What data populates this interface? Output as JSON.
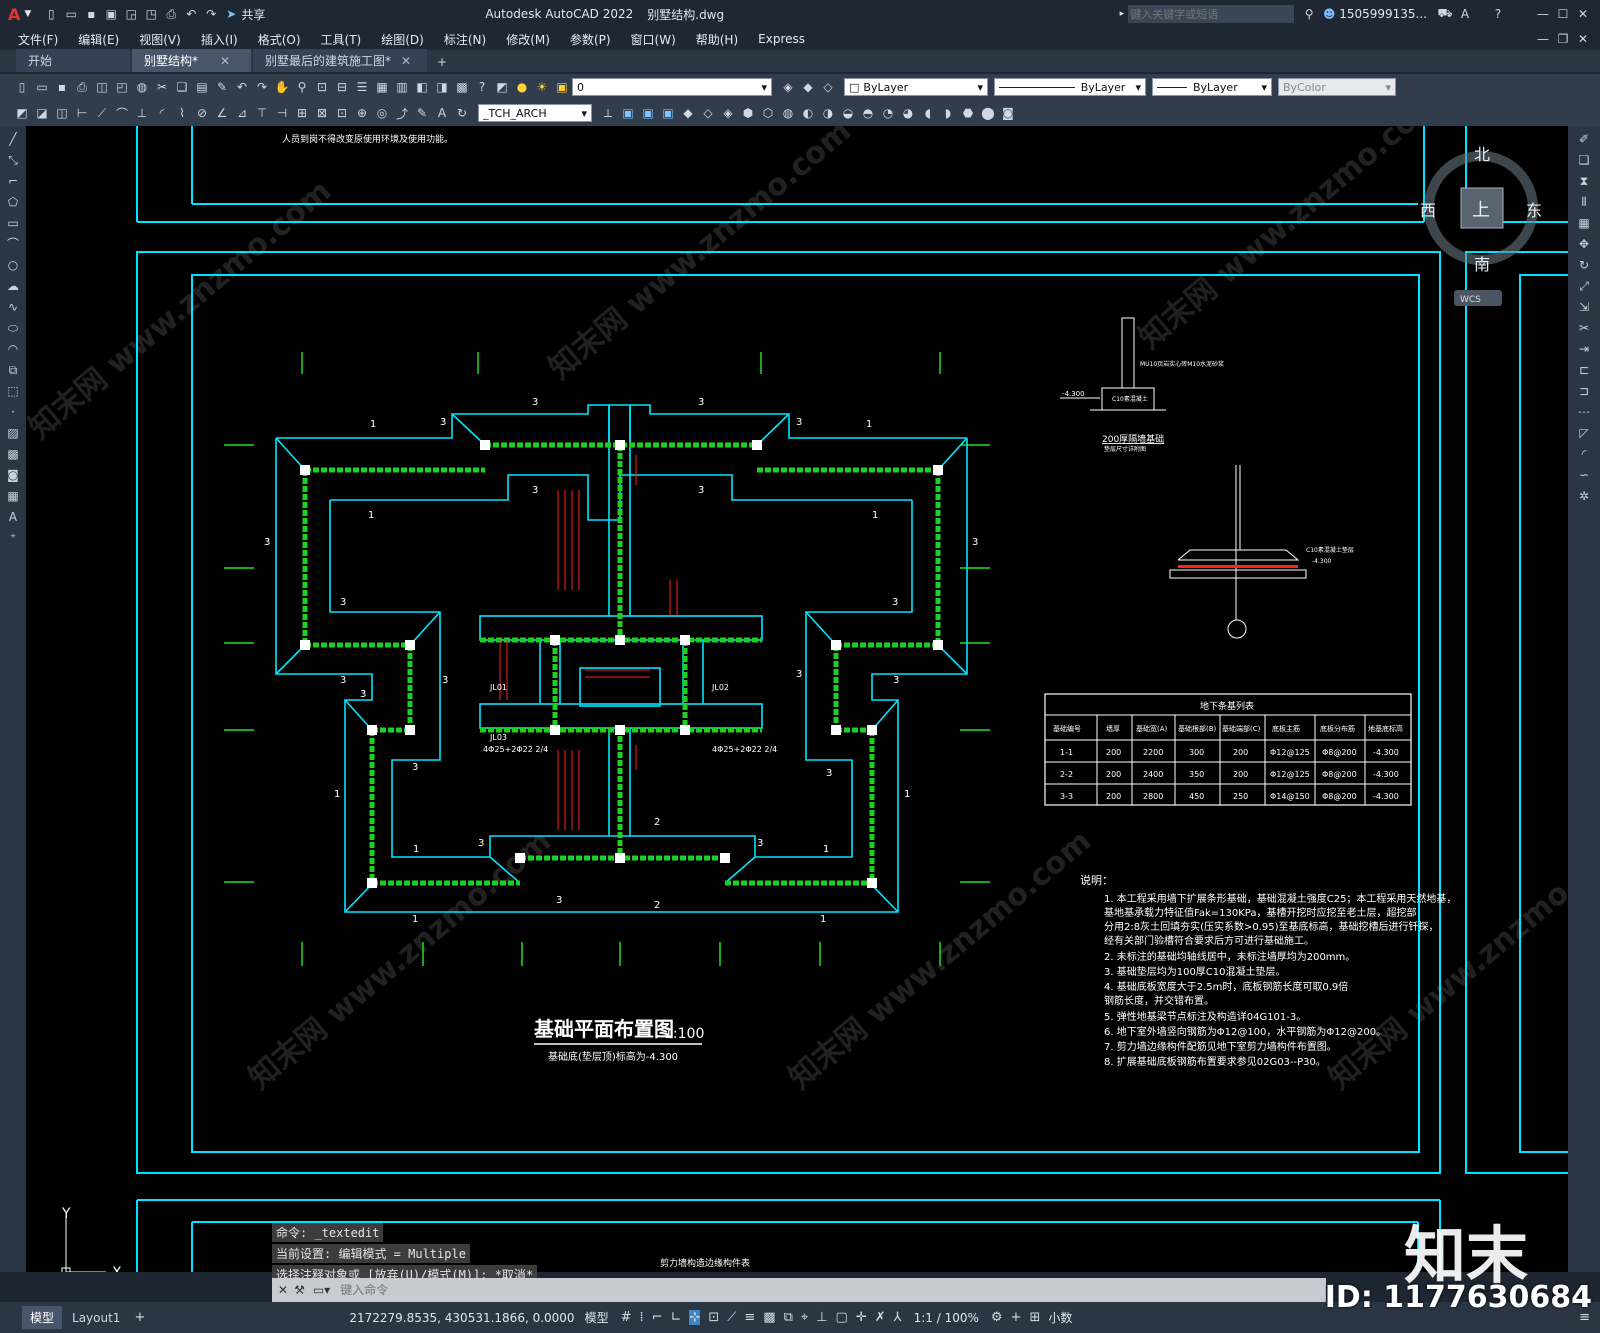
{
  "app": {
    "title": "Autodesk AutoCAD 2022",
    "file": "别墅结构.dwg",
    "search_placeholder": "键入关键字或短语",
    "user": "1505999135...",
    "share": "共享"
  },
  "menu": [
    "文件(F)",
    "编辑(E)",
    "视图(V)",
    "插入(I)",
    "格式(O)",
    "工具(T)",
    "绘图(D)",
    "标注(N)",
    "修改(M)",
    "参数(P)",
    "窗口(W)",
    "帮助(H)",
    "Express"
  ],
  "tabs": [
    {
      "label": "开始",
      "closable": false,
      "active": false
    },
    {
      "label": "别墅结构*",
      "closable": true,
      "active": true
    },
    {
      "label": "别墅最后的建筑施工图*",
      "closable": true,
      "active": false
    }
  ],
  "toolbar": {
    "layer_value": "0",
    "color_value": "ByLayer",
    "linetype_value": "ByLayer",
    "lineweight_value": "ByLayer",
    "plotstyle_value": "ByColor",
    "textstyle_value": "_TCH_ARCH"
  },
  "viewcube": {
    "north": "北",
    "south": "南",
    "east": "东",
    "west": "西",
    "top": "上",
    "wcs": "WCS"
  },
  "drawing": {
    "top_note": "人员到岗不得改变原使用环境及使用功能。",
    "title": "基础平面布置图",
    "scale": "1:100",
    "subtitle": "基础底(垫层顶)标高为-4.300",
    "detail_title": "200厚隔墙基础",
    "detail_sub": "垫层尺寸详附图",
    "detail_label_1": "MU10页岩实心砖M10水泥砂浆",
    "detail_label_2": "C10素混凝土",
    "detail_elev": "-4.300",
    "section_label": "C10素混凝土垫层",
    "section_elev": "-4.300",
    "table": {
      "title": "地下条基列表",
      "headers": [
        "基础编号",
        "墙厚",
        "基础宽(A)",
        "基础根部(B)",
        "基础端部(C)",
        "底板主筋",
        "底板分布筋",
        "地基底标高"
      ],
      "rows": [
        [
          "1-1",
          "200",
          "2200",
          "300",
          "200",
          "Φ12@125",
          "Φ8@200",
          "-4.300"
        ],
        [
          "2-2",
          "200",
          "2400",
          "350",
          "200",
          "Φ12@125",
          "Φ8@200",
          "-4.300"
        ],
        [
          "3-3",
          "200",
          "2800",
          "450",
          "250",
          "Φ14@150",
          "Φ8@200",
          "-4.300"
        ]
      ]
    },
    "notes_title": "说明：",
    "notes": [
      "1. 本工程采用墙下扩展条形基础，基础混凝土强度C25；本工程采用天然地基，",
      "   基地基承载力特征值Fak=130KPa，基槽开挖时应挖至老土层，超挖部",
      "   分用2:8灰土回填夯实(压实系数>0.95)至基底标高，基础挖槽后进行钎探，",
      "   经有关部门验槽符合要求后方可进行基础施工。",
      "2. 未标注的基础均轴线居中，未标注墙厚均为200mm。",
      "3. 基础垫层均为100厚C10混凝土垫层。",
      "4. 基础底板宽度大于2.5m时，底板钢筋长度可取0.9倍",
      "   钢筋长度，并交错布置。",
      "5. 弹性地基梁节点标注及构造详04G101-3。",
      "6. 地下室外墙竖向钢筋为Φ12@100，水平钢筋为Φ12@200。",
      "7. 剪力墙边缘构件配筋见地下室剪力墙构件布置图。",
      "8. 扩展基础底板钢筋布置要求参见02G03--P30。"
    ],
    "section_marks": [
      "1",
      "2",
      "3"
    ],
    "beam_labels": [
      "JL01",
      "JL02",
      "JL03",
      "4Φ25+2Φ22 2/4"
    ],
    "lower_label": "剪力墙构造边缘构件表"
  },
  "command": {
    "history": [
      "命令: _textedit",
      "当前设置: 编辑模式 = Multiple",
      "选择注释对象或 [放弃(U)/模式(M)]: *取消*"
    ],
    "placeholder": "键入命令"
  },
  "status": {
    "layout_tabs": [
      "模型",
      "Layout1"
    ],
    "coords": "2172279.8535, 430531.1866, 0.0000",
    "mode": "模型",
    "scale": "1:1 / 100%",
    "units": "小数"
  },
  "watermark": {
    "logo": "知末",
    "id": "ID: 1177630684",
    "site": "知末网 www.znzmo.com"
  },
  "colors": {
    "cyan": "#00e5ff",
    "green": "#1fd11f",
    "red": "#ff2020",
    "canvas": "#000000"
  }
}
